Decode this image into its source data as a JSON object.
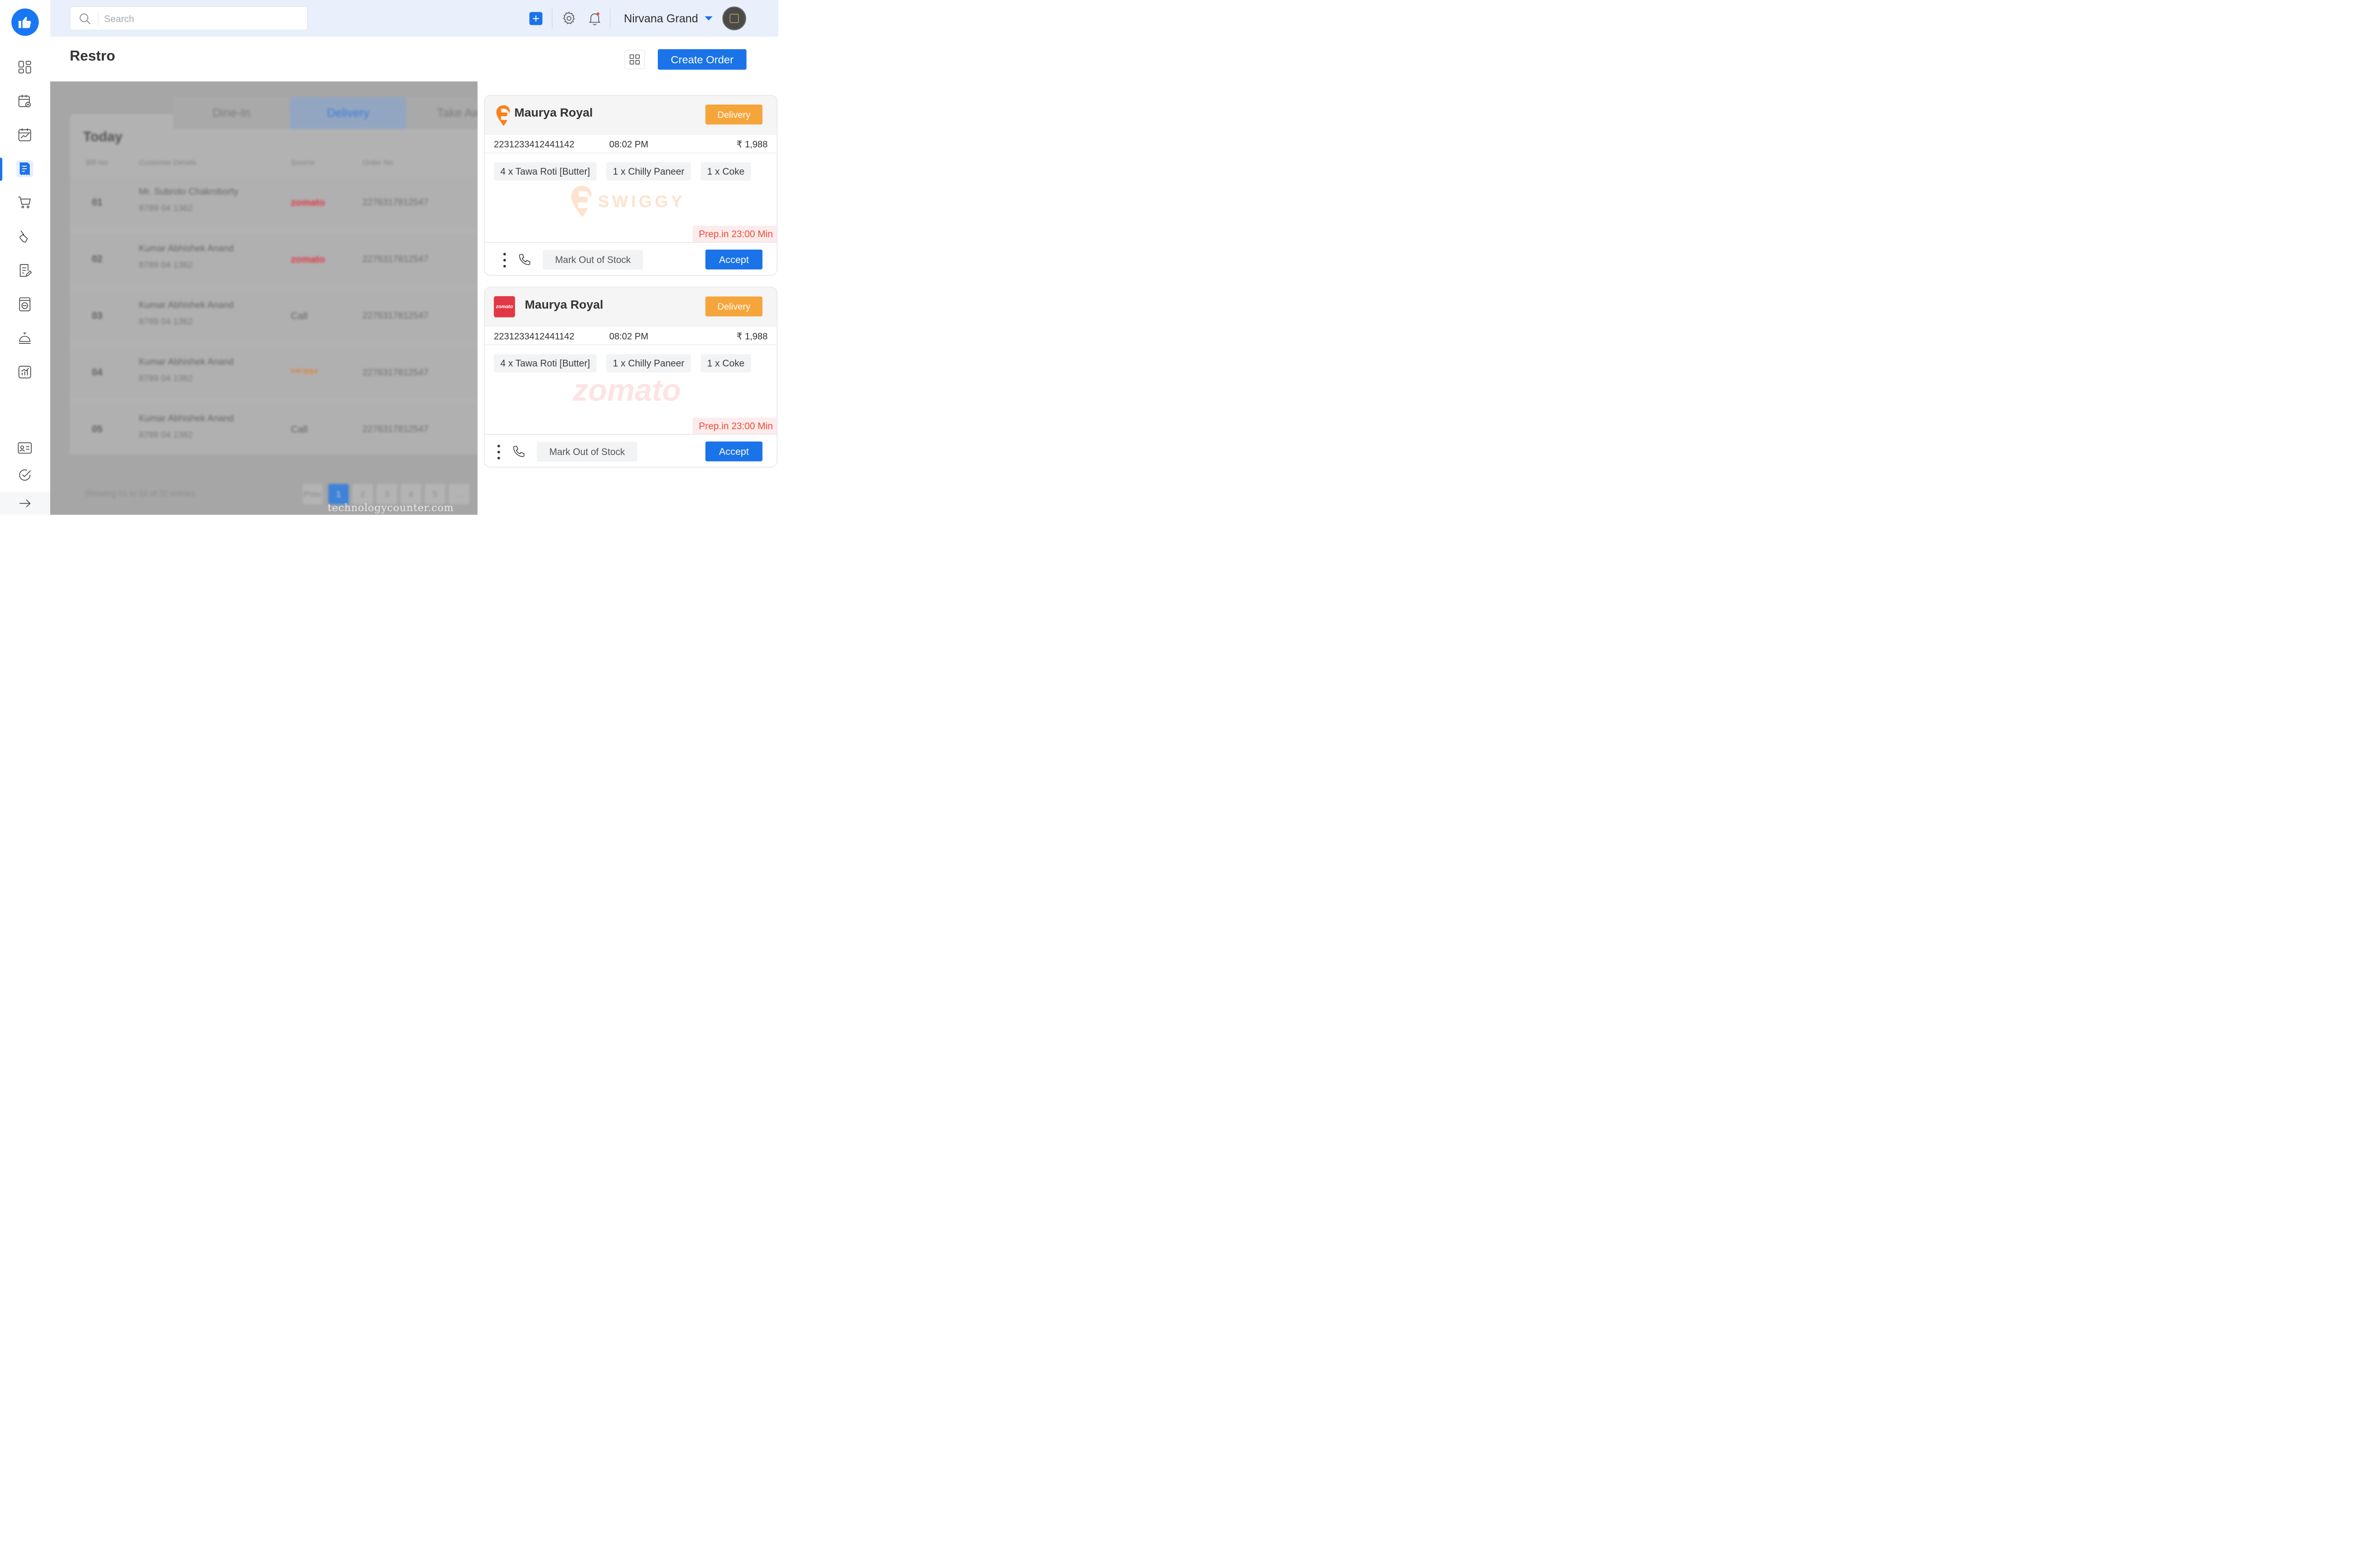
{
  "header": {
    "search_placeholder": "Search",
    "hotel_name": "Nirvana Grand"
  },
  "page": {
    "title": "Restro",
    "create_order_label": "Create Order"
  },
  "background": {
    "tabs": [
      "Dine-In",
      "Delivery",
      "Take Away"
    ],
    "active_tab": "Delivery",
    "section_title": "Today",
    "columns": [
      "Bill No",
      "Customer Details",
      "Source",
      "Order No"
    ],
    "rows": [
      {
        "bill": "01",
        "name": "Mr. Subroto Chakroborty",
        "phone": "8789 04 1362",
        "source": "zomato",
        "order": "2276317812547"
      },
      {
        "bill": "02",
        "name": "Kumar Abhishek Anand",
        "phone": "8789 04 1362",
        "source": "zomato",
        "order": "2276317812547"
      },
      {
        "bill": "03",
        "name": "Kumar Abhishek Anand",
        "phone": "8789 04 1362",
        "source": "Call",
        "order": "2276317812547"
      },
      {
        "bill": "04",
        "name": "Kumar Abhishek Anand",
        "phone": "8789 04 1362",
        "source": "swiggy",
        "order": "2276317812547"
      },
      {
        "bill": "05",
        "name": "Kumar Abhishek Anand",
        "phone": "8789 04 1362",
        "source": "Call",
        "order": "2276317812547"
      }
    ],
    "showing_text": "Showing 01 to 10 of 32 entries",
    "pagination": [
      "Prev",
      "1",
      "2",
      "3",
      "4",
      "5",
      "..."
    ],
    "active_page": "1"
  },
  "orders": [
    {
      "platform": "swiggy",
      "restaurant": "Maurya Royal",
      "type_badge": "Delivery",
      "order_id": "2231233412441142",
      "time": "08:02 PM",
      "amount": "₹ 1,988",
      "items": [
        "4 x Tawa Roti [Butter]",
        "1 x Chilly Paneer",
        "1 x Coke"
      ],
      "watermark": "SWIGGY",
      "prep": "Prep.in 23:00 Min",
      "mark_out_label": "Mark Out of Stock",
      "accept_label": "Accept"
    },
    {
      "platform": "zomato",
      "platform_logo_text": "zomato",
      "restaurant": "Maurya Royal",
      "type_badge": "Delivery",
      "order_id": "2231233412441142",
      "time": "08:02 PM",
      "amount": "₹ 1,988",
      "items": [
        "4 x Tawa Roti [Butter]",
        "1 x Chilly Paneer",
        "1 x Coke"
      ],
      "watermark": "zomato",
      "prep": "Prep.in 23:00 Min",
      "mark_out_label": "Mark Out of Stock",
      "accept_label": "Accept"
    }
  ],
  "site_watermark": "technologycounter.com",
  "colors": {
    "primary": "#1a73e8",
    "badge_orange": "#f6a53a",
    "prep_red": "#e84b3c",
    "swiggy_orange": "#fc8019",
    "zomato_red": "#e23744"
  }
}
